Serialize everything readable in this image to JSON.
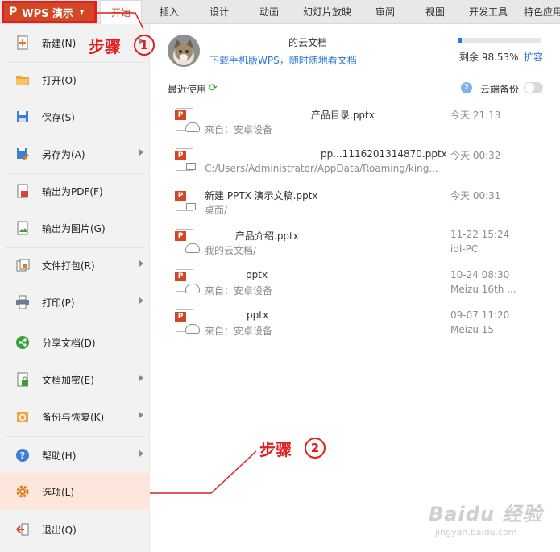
{
  "app_button": {
    "label": "WPS 演示",
    "logo": "P",
    "caret": "▾"
  },
  "tabs": [
    "开始",
    "插入",
    "设计",
    "动画",
    "幻灯片放映",
    "审阅",
    "视图",
    "开发工具",
    "特色应用"
  ],
  "active_tab": "开始",
  "menu": [
    {
      "label": "新建(N)",
      "icon": "new-file-icon",
      "arrow": true
    },
    {
      "label": "打开(O)",
      "icon": "folder-open-icon",
      "arrow": false
    },
    {
      "label": "保存(S)",
      "icon": "save-icon",
      "arrow": false
    },
    {
      "label": "另存为(A)",
      "icon": "save-as-icon",
      "arrow": true
    },
    {
      "label": "输出为PDF(F)",
      "icon": "pdf-icon",
      "arrow": false
    },
    {
      "label": "输出为图片(G)",
      "icon": "image-export-icon",
      "arrow": false
    },
    {
      "label": "文件打包(R)",
      "icon": "package-icon",
      "arrow": true
    },
    {
      "label": "打印(P)",
      "icon": "print-icon",
      "arrow": true
    },
    {
      "label": "分享文档(D)",
      "icon": "share-icon",
      "arrow": false
    },
    {
      "label": "文档加密(E)",
      "icon": "encrypt-icon",
      "arrow": true
    },
    {
      "label": "备份与恢复(K)",
      "icon": "backup-icon",
      "arrow": true
    },
    {
      "label": "帮助(H)",
      "icon": "help-icon",
      "arrow": true
    },
    {
      "label": "选项(L)",
      "icon": "gear-icon",
      "arrow": false,
      "highlighted": true
    },
    {
      "label": "退出(Q)",
      "icon": "exit-icon",
      "arrow": false
    }
  ],
  "cloud": {
    "title": "的云文档",
    "mobile_link": "下载手机版WPS，随时随地看文档",
    "quota_label": "剩余 98.53%",
    "quota_remaining_pct": 98.53,
    "expand_link": "扩容"
  },
  "recent": {
    "title": "最近使用",
    "backup_label": "云端备份",
    "backup_on": false,
    "files": [
      {
        "name": "产品目录.pptx",
        "location": "来自：安卓设备",
        "time": "今天 21:13",
        "device": "",
        "cloud": true
      },
      {
        "name": "pp...1116201314870.pptx",
        "location": "C:/Users/Administrator/AppData/Roaming/king...",
        "time": "今天 00:32",
        "device": "",
        "cloud": false
      },
      {
        "name": "新建 PPTX 演示文稿.pptx",
        "location": "桌面/",
        "time": "今天 00:31",
        "device": "",
        "cloud": false
      },
      {
        "name": "产品介绍.pptx",
        "location": "我的云文档/",
        "time": "11-22 15:24",
        "device": "idl-PC",
        "cloud": true
      },
      {
        "name": "pptx",
        "location": "来自：安卓设备",
        "time": "10-24 08:30",
        "device": "Meizu 16th ...",
        "cloud": true
      },
      {
        "name": "pptx",
        "location": "来自：安卓设备",
        "time": "09-07 11:20",
        "device": "Meizu 15",
        "cloud": true
      }
    ]
  },
  "annotations": {
    "step1_label": "步骤",
    "step1_num": "1",
    "step2_label": "步骤",
    "step2_num": "2",
    "color": "#e02020"
  },
  "watermark": {
    "brand": "Baidu 经验",
    "url": "jingyan.baidu.com"
  },
  "colors": {
    "accent": "#d24726",
    "link": "#2b7ad5",
    "highlight": "#fde7dc"
  }
}
